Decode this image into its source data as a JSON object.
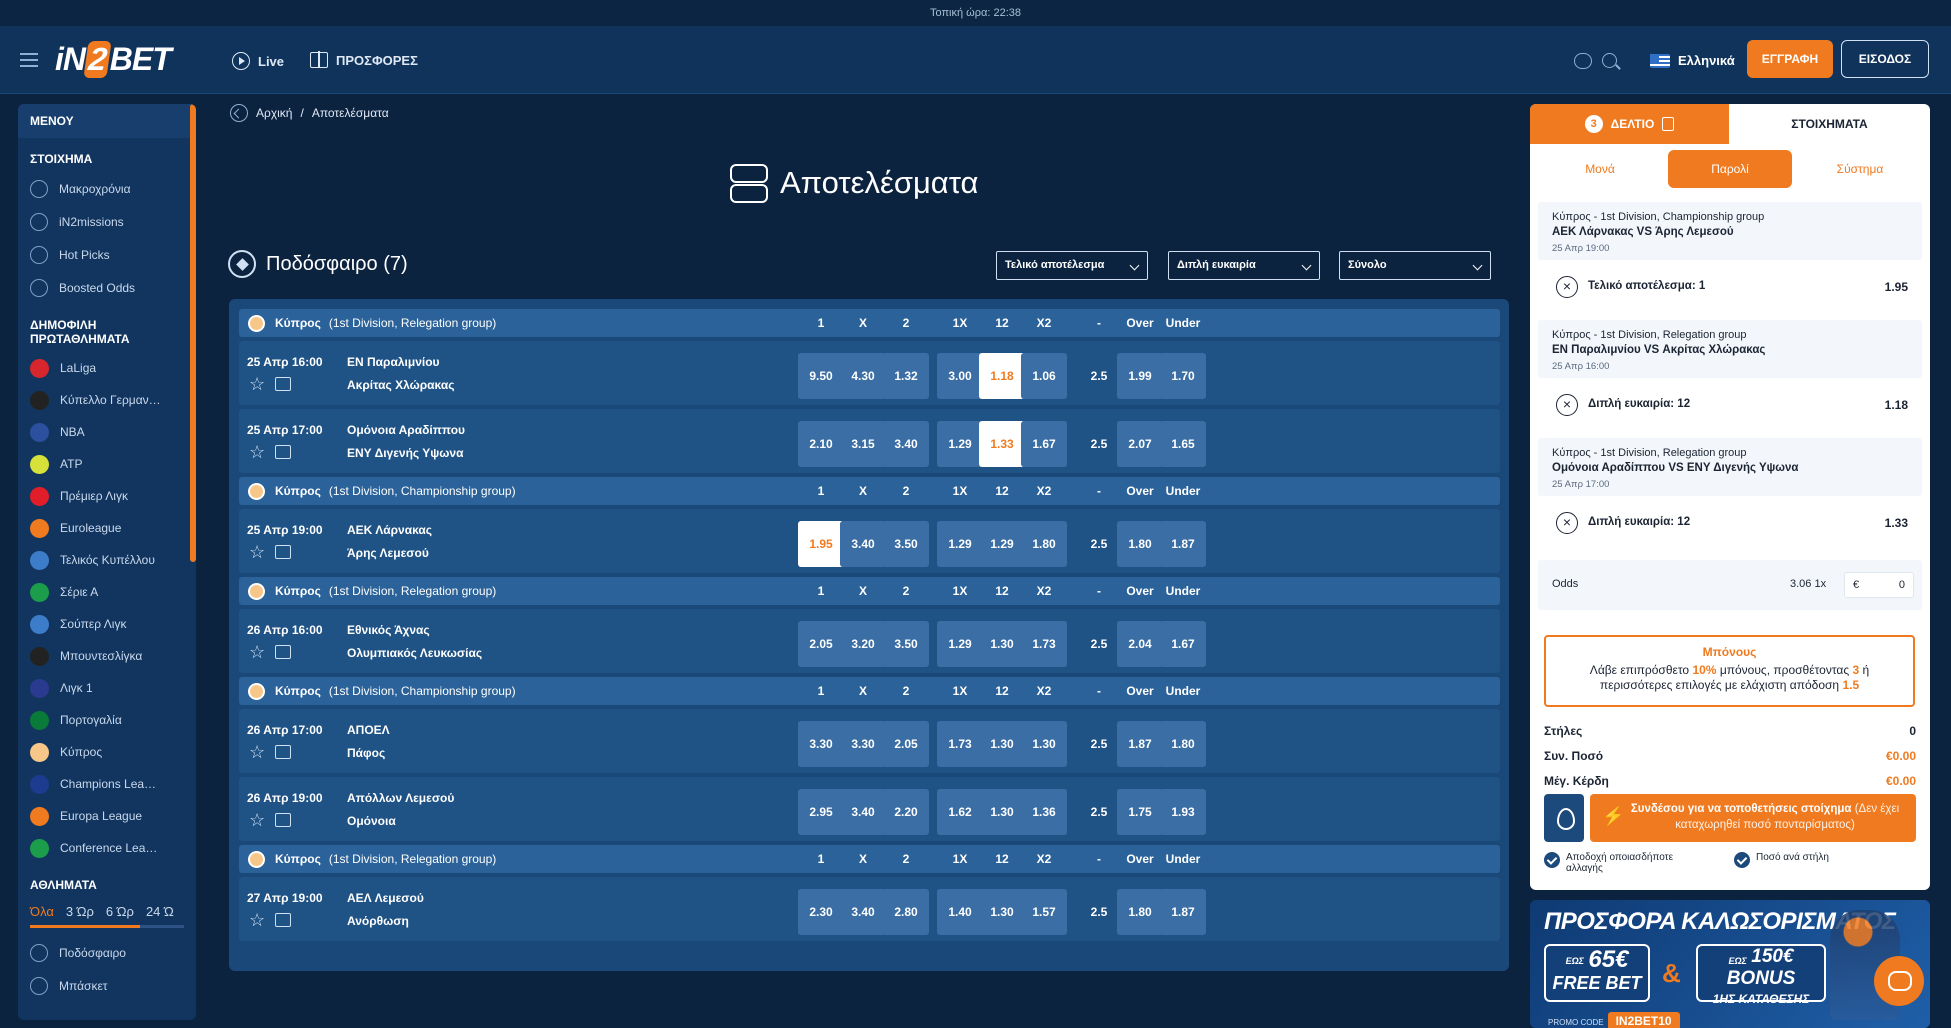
{
  "topbar": {
    "local_time": "Τοπική ώρα: 22:38"
  },
  "header": {
    "logo": {
      "pre": "iN",
      "two": "2",
      "post": "BET"
    },
    "nav": [
      {
        "label": "Live",
        "icon": "play-circle-icon"
      },
      {
        "label": "ΠΡΟΣΦΟΡΕΣ",
        "icon": "gift-icon"
      }
    ],
    "language": "Ελληνικά",
    "register_label": "ΕΓΓΡΑΦΗ",
    "login_label": "ΕΙΣΟΔΟΣ"
  },
  "sidebar": {
    "title": "ΜΕΝΟΥ",
    "section_bet": "ΣΤΟΙΧΗΜΑ",
    "bet_items": [
      {
        "label": "Μακροχρόνια",
        "icon": "trophy-icon"
      },
      {
        "label": "iN2missions",
        "icon": "target-icon"
      },
      {
        "label": "Hot Picks",
        "icon": "flame-icon"
      },
      {
        "label": "Boosted Odds",
        "icon": "rocket-icon"
      }
    ],
    "section_popular": "ΔΗΜΟΦΙΛΗ ΠΡΩΤΑΘΛΗΜΑΤΑ",
    "popular_items": [
      {
        "label": "LaLiga",
        "color": "#d8262e"
      },
      {
        "label": "Κύπελλο Γερμαν…",
        "color": "#222222"
      },
      {
        "label": "NBA",
        "color": "#2c4f9e"
      },
      {
        "label": "ATP",
        "color": "#d6e23a"
      },
      {
        "label": "Πρέμιερ Λιγκ",
        "color": "#e11d2a"
      },
      {
        "label": "Euroleague",
        "color": "#f07a1f"
      },
      {
        "label": "Τελικός Κυπέλλου",
        "color": "#3d7cc9"
      },
      {
        "label": "Σέριε Α",
        "color": "#1b9d4b"
      },
      {
        "label": "Σούπερ Λιγκ",
        "color": "#3d7cc9"
      },
      {
        "label": "Μπουντεσλίγκα",
        "color": "#222222"
      },
      {
        "label": "Λιγκ 1",
        "color": "#2a3b8f"
      },
      {
        "label": "Πορτογαλία",
        "color": "#0a7a38"
      },
      {
        "label": "Κύπρος",
        "color": "#f7c78a"
      },
      {
        "label": "Champions Lea…",
        "color": "#1e3c8f"
      },
      {
        "label": "Europa League",
        "color": "#f07a1f"
      },
      {
        "label": "Conference Lea…",
        "color": "#1b9d4b"
      }
    ],
    "section_sports": "ΑΘΛΗΜΑΤΑ",
    "time_filters": [
      "Όλα",
      "3 Ώρ",
      "6 Ώρ",
      "24 Ώ"
    ],
    "sports_items": [
      {
        "label": "Ποδόσφαιρο",
        "icon": "football-icon"
      },
      {
        "label": "Μπάσκετ",
        "icon": "basketball-icon"
      }
    ]
  },
  "breadcrumb": {
    "home": "Αρχική",
    "sep": "/",
    "current": "Αποτελέσματα"
  },
  "page_title": "Αποτελέσματα",
  "sport_header": "Ποδόσφαιρο (7)",
  "filters": {
    "result": "Τελικό αποτέλεσμα",
    "market": "Διπλή ευκαιρία",
    "total": "Σύνολο"
  },
  "odds_headers": [
    "1",
    "X",
    "2",
    "1X",
    "12",
    "X2",
    "-",
    "Over",
    "Under"
  ],
  "groups": [
    {
      "country": "Κύπρος",
      "league": "(1st Division, Relegation group)"
    },
    {
      "country": "Κύπρος",
      "league": "(1st Division, Championship group)"
    },
    {
      "country": "Κύπρος",
      "league": "(1st Division, Relegation group)"
    },
    {
      "country": "Κύπρος",
      "league": "(1st Division, Championship group)"
    },
    {
      "country": "Κύπρος",
      "league": "(1st Division, Relegation group)"
    }
  ],
  "matches": [
    {
      "date": "25 Απρ 16:00",
      "home": "ΕΝ Παραλιμνίου",
      "away": "Ακρίτας Χλώρακας",
      "odds": [
        "9.50",
        "4.30",
        "1.32",
        "3.00",
        "1.18",
        "1.06",
        "2.5",
        "1.99",
        "1.70"
      ],
      "selected": 4
    },
    {
      "date": "25 Απρ 17:00",
      "home": "Ομόνοια Αραδίππου",
      "away": "ΕΝΥ Διγενής Υψωνα",
      "odds": [
        "2.10",
        "3.15",
        "3.40",
        "1.29",
        "1.33",
        "1.67",
        "2.5",
        "2.07",
        "1.65"
      ],
      "selected": 4
    },
    {
      "date": "25 Απρ 19:00",
      "home": "ΑΕΚ Λάρνακας",
      "away": "Άρης Λεμεσού",
      "odds": [
        "1.95",
        "3.40",
        "3.50",
        "1.29",
        "1.29",
        "1.80",
        "2.5",
        "1.80",
        "1.87"
      ],
      "selected": 0
    },
    {
      "date": "26 Απρ 16:00",
      "home": "Εθνικός Άχνας",
      "away": "Ολυμπιακός Λευκωσίας",
      "odds": [
        "2.05",
        "3.20",
        "3.50",
        "1.29",
        "1.30",
        "1.73",
        "2.5",
        "2.04",
        "1.67"
      ],
      "selected": -1
    },
    {
      "date": "26 Απρ 17:00",
      "home": "ΑΠΟΕΛ",
      "away": "Πάφος",
      "odds": [
        "3.30",
        "3.30",
        "2.05",
        "1.73",
        "1.30",
        "1.30",
        "2.5",
        "1.87",
        "1.80"
      ],
      "selected": -1
    },
    {
      "date": "26 Απρ 19:00",
      "home": "Απόλλων Λεμεσού",
      "away": "Ομόνοια",
      "odds": [
        "2.95",
        "3.40",
        "2.20",
        "1.62",
        "1.30",
        "1.36",
        "2.5",
        "1.75",
        "1.93"
      ],
      "selected": -1
    },
    {
      "date": "27 Απρ 19:00",
      "home": "ΑΕΛ Λεμεσού",
      "away": "Ανόρθωση",
      "odds": [
        "2.30",
        "3.40",
        "2.80",
        "1.40",
        "1.30",
        "1.57",
        "2.5",
        "1.80",
        "1.87"
      ],
      "selected": -1
    }
  ],
  "betslip": {
    "count": "3",
    "tab_slip": "ΔΕΛΤΙΟ",
    "tab_bets": "ΣΤΟΙΧΗΜΑΤΑ",
    "subtabs": [
      "Μονά",
      "Παρολί",
      "Σύστημα"
    ],
    "bets": [
      {
        "league": "Κύπρος - 1st Division, Championship group",
        "match": "ΑΕΚ Λάρνακας VS Άρης Λεμεσού",
        "date": "25 Απρ 19:00",
        "pick": "Τελικό αποτέλεσμα: 1",
        "odd": "1.95"
      },
      {
        "league": "Κύπρος - 1st Division, Relegation group",
        "match": "ΕΝ Παραλιμνίου VS Ακρίτας Χλώρακας",
        "date": "25 Απρ 16:00",
        "pick": "Διπλή ευκαιρία: 12",
        "odd": "1.18"
      },
      {
        "league": "Κύπρος - 1st Division, Relegation group",
        "match": "Ομόνοια Αραδίππου VS ΕΝΥ Διγενής Υψωνα",
        "date": "25 Απρ 17:00",
        "pick": "Διπλή ευκαιρία: 12",
        "odd": "1.33"
      }
    ],
    "odds_label": "Odds",
    "odds_value": "3.06",
    "multiplier": "1x",
    "currency": "€",
    "stake": "0",
    "bonus_title": "Μπόνους",
    "bonus_text_1": "Λάβε επιπρόσθετο",
    "bonus_pct": "10%",
    "bonus_text_2": "μπόνους, προσθέτοντας",
    "bonus_n": "3",
    "bonus_text_3": "ή περισσότερες επιλογές με ελάχιστη απόδοση",
    "bonus_min": "1.5",
    "lines_label": "Στήλες",
    "lines_value": "0",
    "total_label": "Συν. Ποσό",
    "total_value": "€0.00",
    "win_label": "Μέγ. Κέρδη",
    "win_value": "€0.00",
    "login_btn": "Συνδέσου για να τοποθετήσεις στοίχημα",
    "login_btn_note": "(Δεν έχει καταχωρηθεί ποσό πονταρίσματος)",
    "accept_changes": "Αποδοχή οποιασδήποτε αλλαγής",
    "per_line": "Ποσό ανά στήλη"
  },
  "banner": {
    "title": "ΠΡΟΣΦΟΡΑ ΚΑΛΩΣΟΡΙΣΜΑΤΟΣ",
    "card1_up": "ΕΩΣ",
    "card1_amount": "65€",
    "card1_label": "FREE BET",
    "amp": "&",
    "card2_up": "ΕΩΣ",
    "card2_amount": "150€ BONUS",
    "card2_label": "1ΗΣ ΚΑΤΑΘΕΣΗΣ",
    "promo_label": "PROMO CODE",
    "promo_code": "IN2BET10"
  },
  "colors": {
    "accent": "#f07a1f",
    "bg": "#0c2340",
    "panel": "#1a4879"
  }
}
